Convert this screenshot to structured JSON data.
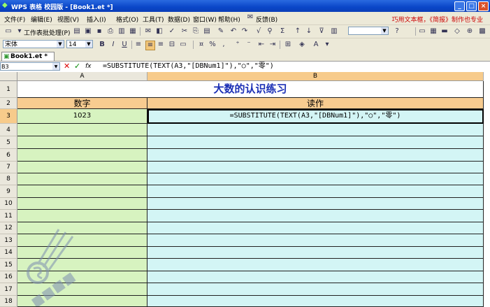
{
  "window": {
    "title": "WPS 表格 校园版 - [Book1.et *]",
    "btn_min": "_",
    "btn_max": "□",
    "btn_close": "×"
  },
  "menu": {
    "items": [
      "文件(F)",
      "编辑(E)",
      "视图(V)",
      "插入(I)",
      "格式(O)",
      "工具(T)",
      "数据(D)",
      "窗口(W)",
      "帮助(H)",
      "反馈(B)"
    ],
    "promo": "巧用文本框，《简报》制作也专业"
  },
  "toolbar": {
    "table_process": "工作表批处理(P)"
  },
  "format_bar": {
    "font_name": "宋体",
    "font_size": "14",
    "bold": "B",
    "italic": "I",
    "underline": "U"
  },
  "doc_tab": {
    "label": "Book1.et *"
  },
  "formula_bar": {
    "name_box": "B3",
    "fx": "fx",
    "formula": "=SUBSTITUTE(TEXT(A3,\"[DBNum1]\"),\"○\",\"零\")"
  },
  "sheet": {
    "columns": [
      "A",
      "B"
    ],
    "rows": [
      "1",
      "2",
      "3",
      "4",
      "5",
      "6",
      "7",
      "8",
      "9",
      "10",
      "11",
      "12",
      "13",
      "14",
      "15",
      "16",
      "17",
      "18"
    ],
    "title": "大数的认识练习",
    "header_a": "数字",
    "header_b": "读作",
    "a3": "1023",
    "b3": "=SUBSTITUTE(TEXT(A3,\"[DBNum1]\"),\"○\",\"零\")",
    "selected_cell": "B3"
  },
  "colors": {
    "title_text": "#1b2fb5",
    "header_fill": "#F8CC90",
    "col_a_fill": "#D7F3C0",
    "col_b_fill": "#D3F5F5",
    "titlebar": "#0A46C8"
  }
}
